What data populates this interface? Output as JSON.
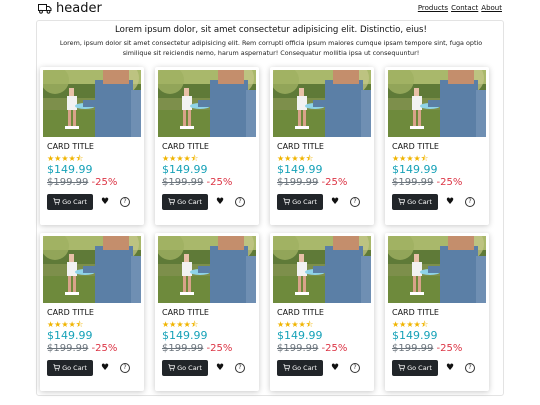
{
  "header": {
    "brand_icon": "truck-icon",
    "title": "header",
    "nav": [
      "Products",
      "Contact",
      "About"
    ]
  },
  "main": {
    "headline": "Lorem ipsum dolor, sit amet consectetur adipisicing elit. Distinctio, eius!",
    "intro": "Lorem, ipsum dolor sit amet consectetur adipisicing elit. Rem corrupti officia ipsum maiores cumque ipsam tempore sint, fuga optio similique sit reiciendis nemo, harum aspernatur! Consequatur mollitia ipsa ut consequuntur!"
  },
  "cards": [
    {
      "title": "CARD TITLE",
      "rating": 4.5,
      "stars": "★★★★⯪",
      "price": "$149.99",
      "old_price": "$199.99",
      "discount": "-25%",
      "button": "Go Cart"
    },
    {
      "title": "CARD TITLE",
      "rating": 4.5,
      "stars": "★★★★⯪",
      "price": "$149.99",
      "old_price": "$199.99",
      "discount": "-25%",
      "button": "Go Cart"
    },
    {
      "title": "CARD TITLE",
      "rating": 4.5,
      "stars": "★★★★⯪",
      "price": "$149.99",
      "old_price": "$199.99",
      "discount": "-25%",
      "button": "Go Cart"
    },
    {
      "title": "CARD TITLE",
      "rating": 4.5,
      "stars": "★★★★⯪",
      "price": "$149.99",
      "old_price": "$199.99",
      "discount": "-25%",
      "button": "Go Cart"
    },
    {
      "title": "CARD TITLE",
      "rating": 4.5,
      "stars": "★★★★⯪",
      "price": "$149.99",
      "old_price": "$199.99",
      "discount": "-25%",
      "button": "Go Cart"
    },
    {
      "title": "CARD TITLE",
      "rating": 4.5,
      "stars": "★★★★⯪",
      "price": "$149.99",
      "old_price": "$199.99",
      "discount": "-25%",
      "button": "Go Cart"
    },
    {
      "title": "CARD TITLE",
      "rating": 4.5,
      "stars": "★★★★⯪",
      "price": "$149.99",
      "old_price": "$199.99",
      "discount": "-25%",
      "button": "Go Cart"
    },
    {
      "title": "CARD TITLE",
      "rating": 4.5,
      "stars": "★★★★⯪",
      "price": "$149.99",
      "old_price": "$199.99",
      "discount": "-25%",
      "button": "Go Cart"
    }
  ],
  "icons": {
    "cart": "cart-icon",
    "favorite": "heart-icon",
    "help": "question-icon"
  },
  "colors": {
    "price": "#17a2b8",
    "discount": "#dc3545",
    "old_price": "#6c757d",
    "button": "#212529",
    "star": "#f0b400"
  }
}
